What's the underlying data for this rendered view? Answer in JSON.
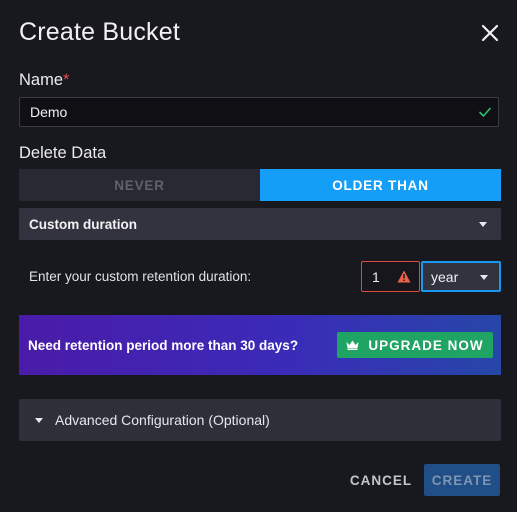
{
  "dialog": {
    "title": "Create Bucket"
  },
  "name_field": {
    "label": "Name",
    "required_marker": "*",
    "value": "Demo"
  },
  "delete_data": {
    "label": "Delete Data",
    "options": [
      "NEVER",
      "OLDER THAN"
    ],
    "selected": "OLDER THAN"
  },
  "retention_type": {
    "selected": "Custom duration"
  },
  "custom_duration": {
    "label": "Enter your custom retention duration:",
    "value": "1",
    "unit": "year"
  },
  "upgrade": {
    "text": "Need retention period more than 30 days?",
    "button_label": "UPGRADE NOW"
  },
  "advanced": {
    "label": "Advanced Configuration (Optional)"
  },
  "footer": {
    "cancel_label": "CANCEL",
    "create_label": "CREATE"
  },
  "colors": {
    "background": "#18181f",
    "accent": "#159ef8",
    "success": "#20a464",
    "error": "#dc4b40"
  }
}
